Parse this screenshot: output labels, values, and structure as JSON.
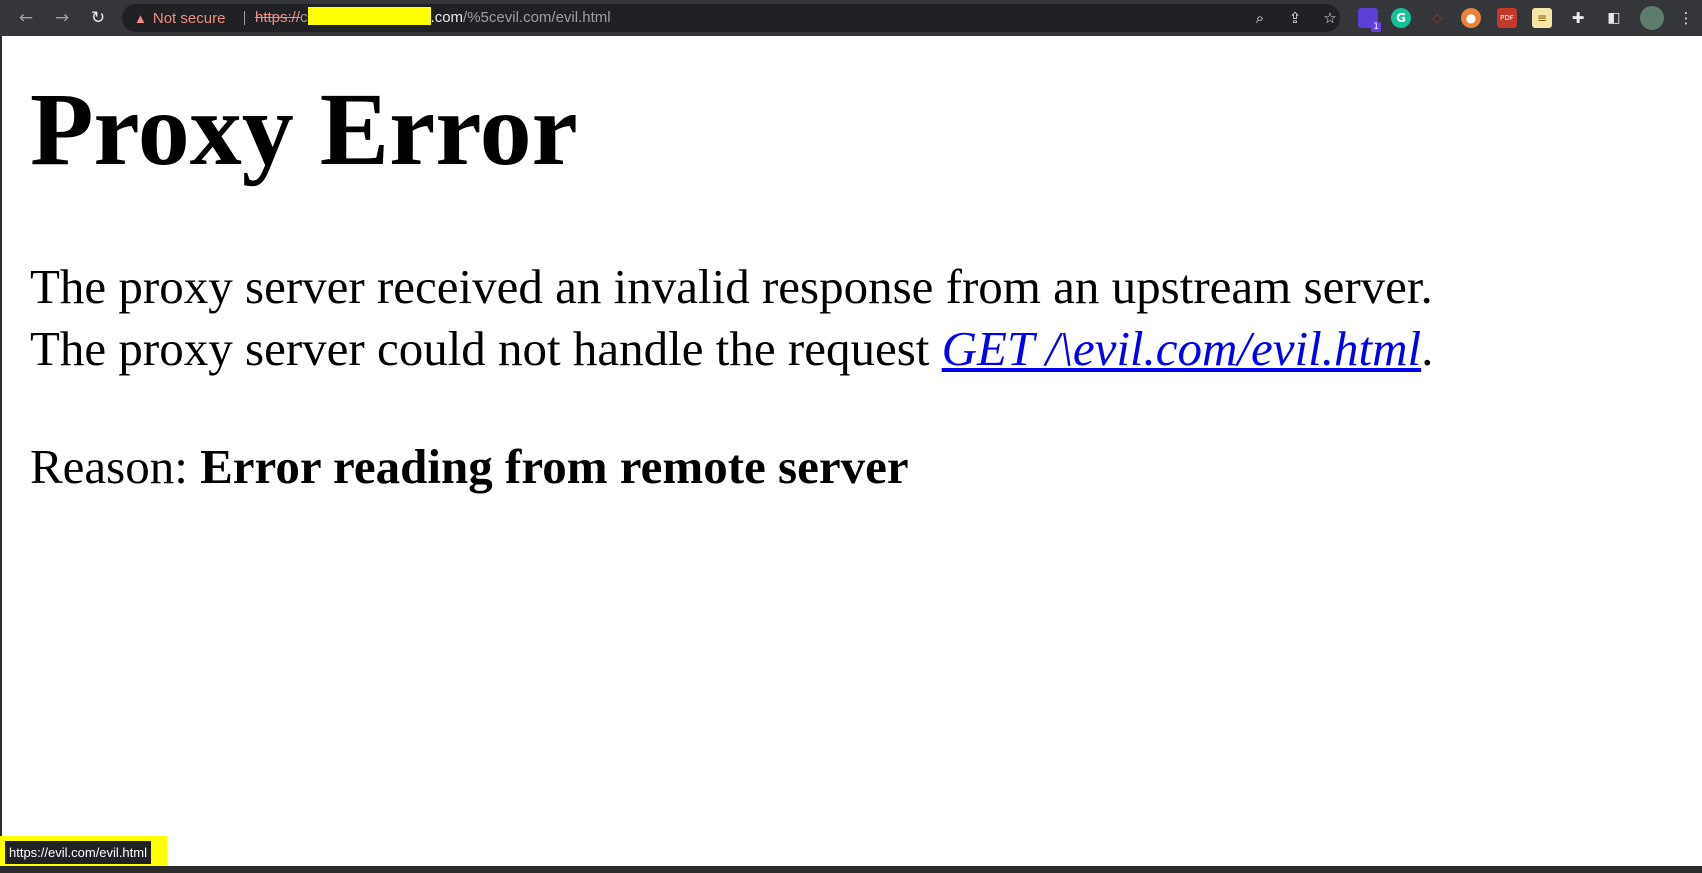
{
  "browser": {
    "security_label": "Not secure",
    "url_scheme": "https://",
    "url_prefix_fragment": "c",
    "url_host_suffix": ".com",
    "url_path": "/%5cevil.com/evil.html",
    "profile_badge_count": "1",
    "extension_icon_labels": [
      "G",
      "PDF"
    ]
  },
  "page": {
    "title": "Proxy Error",
    "line1": "The proxy server received an invalid response from an upstream server.",
    "line2_prefix": "The proxy server could not handle the request ",
    "request_link": "GET /\\evil.com/evil.html",
    "line2_suffix": ".",
    "reason_label": "Reason: ",
    "reason_text": "Error reading from remote server"
  },
  "status_bar": {
    "hover_url": "https://evil.com/evil.html"
  },
  "colors": {
    "chrome_bg": "#35363a",
    "omnibox_bg": "#202124",
    "warning_red": "#f28b82",
    "link_blue": "#0000ee",
    "highlight_yellow": "#ffff00"
  }
}
